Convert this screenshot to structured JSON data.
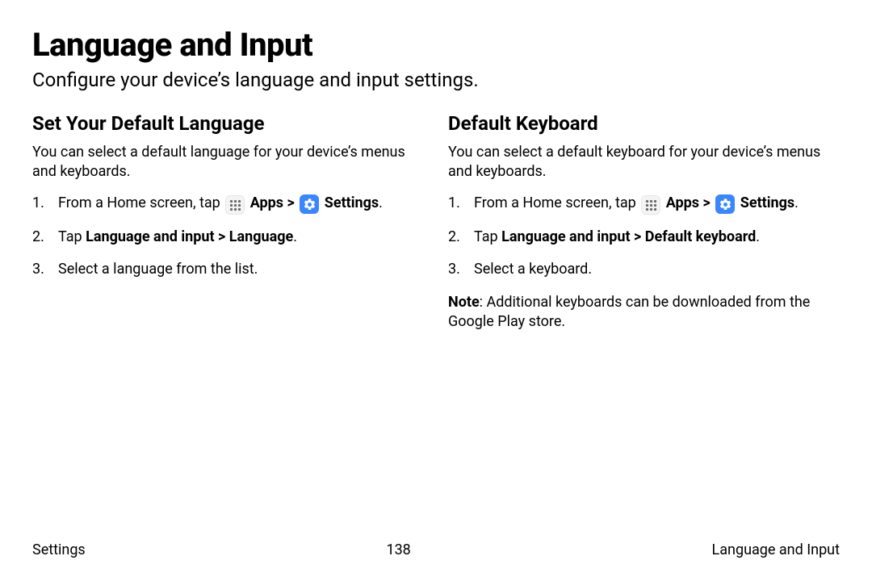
{
  "page": {
    "title": "Language and Input",
    "subtitle": "Configure your device’s language and input settings."
  },
  "left": {
    "heading": "Set Your Default Language",
    "description": "You can select a default language for your device’s menus and keyboards.",
    "step1_prefix": "From a Home screen, tap ",
    "apps_label": "Apps",
    "chevron": " > ",
    "settings_label": "Settings",
    "period": ".",
    "step2_prefix": "Tap ",
    "step2_bold": "Language and input > Language",
    "step3": "Select a language from the list."
  },
  "right": {
    "heading": "Default Keyboard",
    "description": "You can select a default keyboard for your device’s menus and keyboards.",
    "step1_prefix": "From a Home screen, tap ",
    "apps_label": "Apps",
    "chevron": " > ",
    "settings_label": "Settings",
    "period": ".",
    "step2_prefix": "Tap ",
    "step2_bold": "Language and input > Default keyboard",
    "step3": "Select a keyboard.",
    "note_label": "Note",
    "note_text": ": Additional keyboards can be downloaded from the Google Play store."
  },
  "footer": {
    "left": "Settings",
    "center": "138",
    "right": "Language and Input"
  }
}
